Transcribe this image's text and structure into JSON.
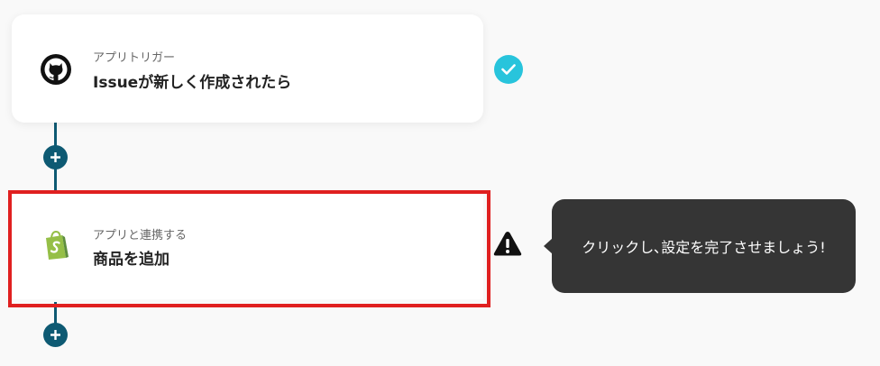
{
  "trigger_step": {
    "type_label": "アプリトリガー",
    "title": "Issueが新しく作成されたら",
    "app_icon": "github-icon",
    "status": "complete"
  },
  "action_step": {
    "type_label": "アプリと連携する",
    "title": "商品を追加",
    "app_icon": "shopify-icon",
    "status": "incomplete"
  },
  "tooltip": {
    "text": "クリックし､設定を完了させましょう!"
  },
  "colors": {
    "connector": "#0e5a73",
    "check": "#28c4dc",
    "highlight_border": "#e02020",
    "tooltip_bg": "#353535",
    "shopify_green": "#95bf47"
  }
}
